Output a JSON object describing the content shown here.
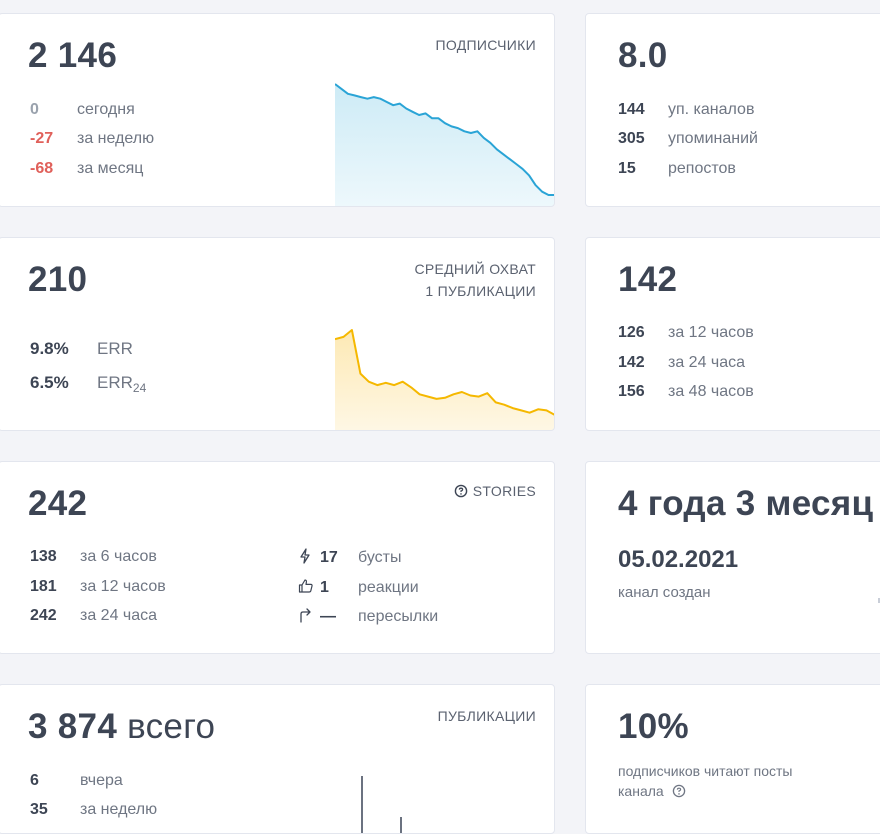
{
  "subscribers": {
    "total": "2 146",
    "label": "ПОДПИСЧИКИ",
    "rows": [
      {
        "value": "0",
        "text": "сегодня",
        "tone": "gray"
      },
      {
        "value": "-27",
        "text": "за неделю",
        "tone": "red"
      },
      {
        "value": "-68",
        "text": "за месяц",
        "tone": "red"
      }
    ],
    "chart_data": {
      "type": "area",
      "color": "#2aa4d6",
      "fill": "#cdebf6",
      "values": [
        2214,
        2211,
        2208,
        2207,
        2206,
        2205,
        2206,
        2205,
        2203,
        2201,
        2202,
        2199,
        2197,
        2195,
        2196,
        2193,
        2193,
        2190,
        2188,
        2187,
        2185,
        2184,
        2185,
        2181,
        2178,
        2174,
        2171,
        2168,
        2165,
        2162,
        2158,
        2152,
        2148,
        2146,
        2146
      ]
    }
  },
  "citation": {
    "index": "8.0",
    "rows": [
      {
        "value": "144",
        "text": "уп. каналов"
      },
      {
        "value": "305",
        "text": "упоминаний"
      },
      {
        "value": "15",
        "text": "репостов"
      }
    ]
  },
  "reach": {
    "total": "210",
    "label_line1": "СРЕДНИЙ ОХВАТ",
    "label_line2": "1 ПУБЛИКАЦИИ",
    "err_rows": [
      {
        "value": "9.8%",
        "text": "ERR",
        "sub": ""
      },
      {
        "value": "6.5%",
        "text": "ERR",
        "sub": "24"
      }
    ],
    "chart_data": {
      "type": "area",
      "color": "#f5b800",
      "fill": "#fde9b4",
      "values": [
        300,
        302,
        308,
        270,
        263,
        260,
        262,
        260,
        263,
        258,
        252,
        250,
        248,
        249,
        252,
        254,
        251,
        250,
        253,
        245,
        243,
        240,
        238,
        236,
        239,
        238,
        234
      ]
    }
  },
  "views": {
    "total": "142",
    "rows": [
      {
        "value": "126",
        "text": "за 12 часов"
      },
      {
        "value": "142",
        "text": "за 24 часа"
      },
      {
        "value": "156",
        "text": "за 48 часов"
      }
    ]
  },
  "stories": {
    "total": "242",
    "label": "STORIES",
    "rows": [
      {
        "value": "138",
        "text": "за 6 часов"
      },
      {
        "value": "181",
        "text": "за 12 часов"
      },
      {
        "value": "242",
        "text": "за 24 часа"
      }
    ],
    "extra": [
      {
        "icon": "bolt-icon",
        "value": "17",
        "text": "бусты"
      },
      {
        "icon": "thumbs-up-icon",
        "value": "1",
        "text": "реакции"
      },
      {
        "icon": "share-arrow-icon",
        "value": "—",
        "text": "пересылки"
      }
    ]
  },
  "age": {
    "title": "4 года 3 месяц",
    "date": "05.02.2021",
    "caption": "канал создан"
  },
  "publications": {
    "total": "3 874",
    "suffix": "всего",
    "label": "ПУБЛИКАЦИИ",
    "rows": [
      {
        "value": "6",
        "text": "вчера"
      },
      {
        "value": "35",
        "text": "за неделю"
      }
    ]
  },
  "readers": {
    "percent": "10%",
    "caption_line1": "подписчиков читают посты",
    "caption_line2": "канала"
  }
}
